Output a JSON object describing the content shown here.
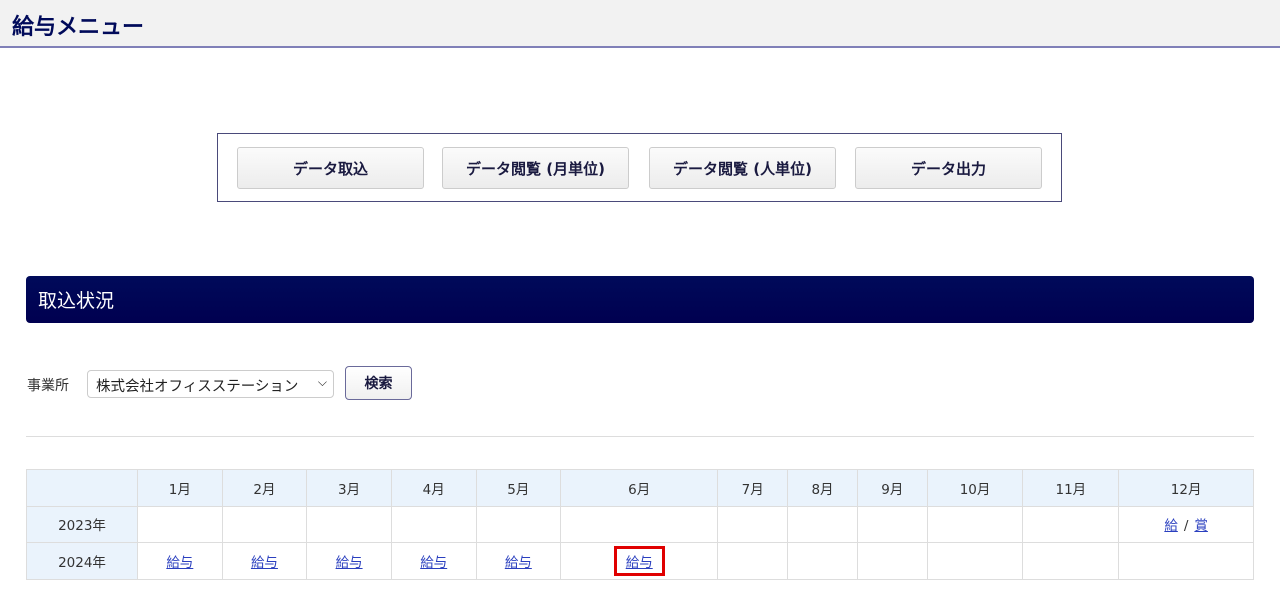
{
  "header": {
    "title": "給与メニュー"
  },
  "menu": [
    "データ取込",
    "データ閲覧 (月単位)",
    "データ閲覧 (人単位)",
    "データ出力"
  ],
  "section": {
    "title": "取込状況"
  },
  "filter": {
    "label": "事業所",
    "selected": "株式会社オフィスステーション",
    "search_label": "検索"
  },
  "table": {
    "months": [
      "1月",
      "2月",
      "3月",
      "4月",
      "5月",
      "6月",
      "7月",
      "8月",
      "9月",
      "10月",
      "11月",
      "12月"
    ],
    "rows": [
      {
        "year": "2023年",
        "cells": [
          "",
          "",
          "",
          "",
          "",
          "",
          "",
          "",
          "",
          "",
          "",
          ""
        ],
        "dec": {
          "a": "給",
          "sep": "/",
          "b": "賞"
        }
      },
      {
        "year": "2024年",
        "cells": [
          "給与",
          "給与",
          "給与",
          "給与",
          "給与",
          "給与",
          "",
          "",
          "",
          "",
          "",
          ""
        ]
      }
    ]
  },
  "highlight": {
    "color": "#e00000",
    "row": 1,
    "col": 5
  }
}
